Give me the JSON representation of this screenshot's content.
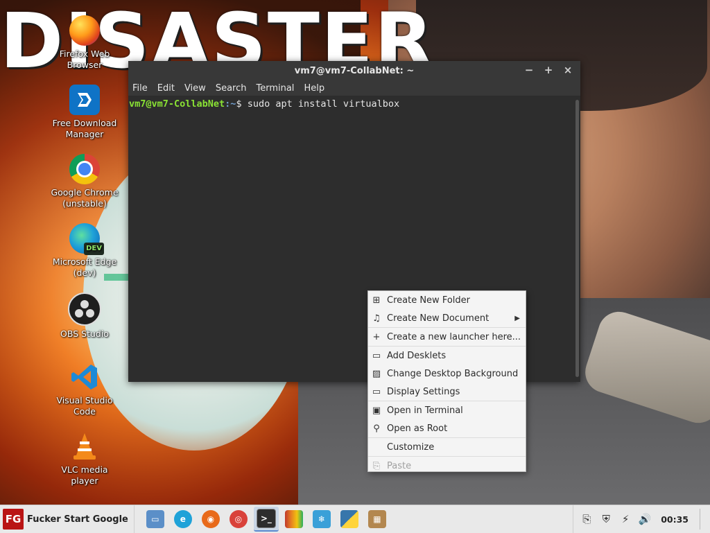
{
  "wallpaper": {
    "title_text": "DISASTER"
  },
  "desktop_icons": [
    {
      "label": "Firefox Web Browser",
      "icon": "firefox-icon"
    },
    {
      "label": "Free Download Manager",
      "icon": "free-download-manager-icon"
    },
    {
      "label": "Google Chrome (unstable)",
      "icon": "chrome-icon"
    },
    {
      "label": "Microsoft Edge (dev)",
      "icon": "edge-dev-icon",
      "badge": "DEV"
    },
    {
      "label": "OBS Studio",
      "icon": "obs-icon"
    },
    {
      "label": "Visual Studio Code",
      "icon": "vscode-icon"
    },
    {
      "label": "VLC media player",
      "icon": "vlc-icon"
    }
  ],
  "terminal": {
    "title": "vm7@vm7-CollabNet: ~",
    "controls": {
      "minimize": "−",
      "maximize": "+",
      "close": "×"
    },
    "menu": [
      "File",
      "Edit",
      "View",
      "Search",
      "Terminal",
      "Help"
    ],
    "prompt_user": "vm7@vm7-CollabNet",
    "prompt_path": ":~",
    "prompt_symbol": "$",
    "command": " sudo apt install virtualbox"
  },
  "context_menu": {
    "items": [
      {
        "label": "Create New Folder",
        "icon": "new-folder-icon",
        "glyph": "⊞"
      },
      {
        "label": "Create New Document",
        "icon": "new-document-icon",
        "glyph": "♫",
        "submenu_arrow": "▶"
      },
      {
        "label": "Create a new launcher here...",
        "icon": "plus-icon",
        "glyph": "+"
      },
      {
        "label": "Add Desklets",
        "icon": "desklet-icon",
        "glyph": "▭"
      },
      {
        "label": "Change Desktop Background",
        "icon": "image-icon",
        "glyph": "▨"
      },
      {
        "label": "Display Settings",
        "icon": "display-icon",
        "glyph": "▭"
      },
      {
        "label": "Open in Terminal",
        "icon": "terminal-icon",
        "glyph": "▣"
      },
      {
        "label": "Open as Root",
        "icon": "key-icon",
        "glyph": "⚲"
      },
      {
        "label": "Customize",
        "icon": "",
        "glyph": ""
      },
      {
        "label": "Paste",
        "icon": "paste-icon",
        "glyph": "⎘",
        "disabled": true
      }
    ]
  },
  "taskbar": {
    "start_logo": "FG",
    "start_label": "Fucker Start Google",
    "launchers": [
      {
        "name": "files-icon",
        "color": "#5b8fc8",
        "glyph": "▭"
      },
      {
        "name": "edge-dev-icon",
        "color": "#1fa2d8",
        "glyph": "e"
      },
      {
        "name": "firefox-icon",
        "color": "#e86a1a",
        "glyph": "◉"
      },
      {
        "name": "chrome-icon",
        "color": "#d9423a",
        "glyph": "◎"
      },
      {
        "name": "terminal-icon",
        "color": "#2d2d2d",
        "glyph": ">_",
        "active": true
      },
      {
        "name": "color-bars-icon",
        "color": "#c0392b",
        "glyph": "▥"
      },
      {
        "name": "snowflake-icon",
        "color": "#3aa0d8",
        "glyph": "❄"
      },
      {
        "name": "python-icon",
        "color": "#3776ab",
        "glyph": "⚕"
      },
      {
        "name": "package-icon",
        "color": "#b3874f",
        "glyph": "▦"
      }
    ],
    "tray": [
      {
        "name": "clipboard-icon",
        "glyph": "⎘"
      },
      {
        "name": "shield-icon",
        "glyph": "⛨"
      },
      {
        "name": "network-icon",
        "glyph": "⚡"
      },
      {
        "name": "volume-icon",
        "glyph": "🔊"
      }
    ],
    "clock": "00:35"
  }
}
